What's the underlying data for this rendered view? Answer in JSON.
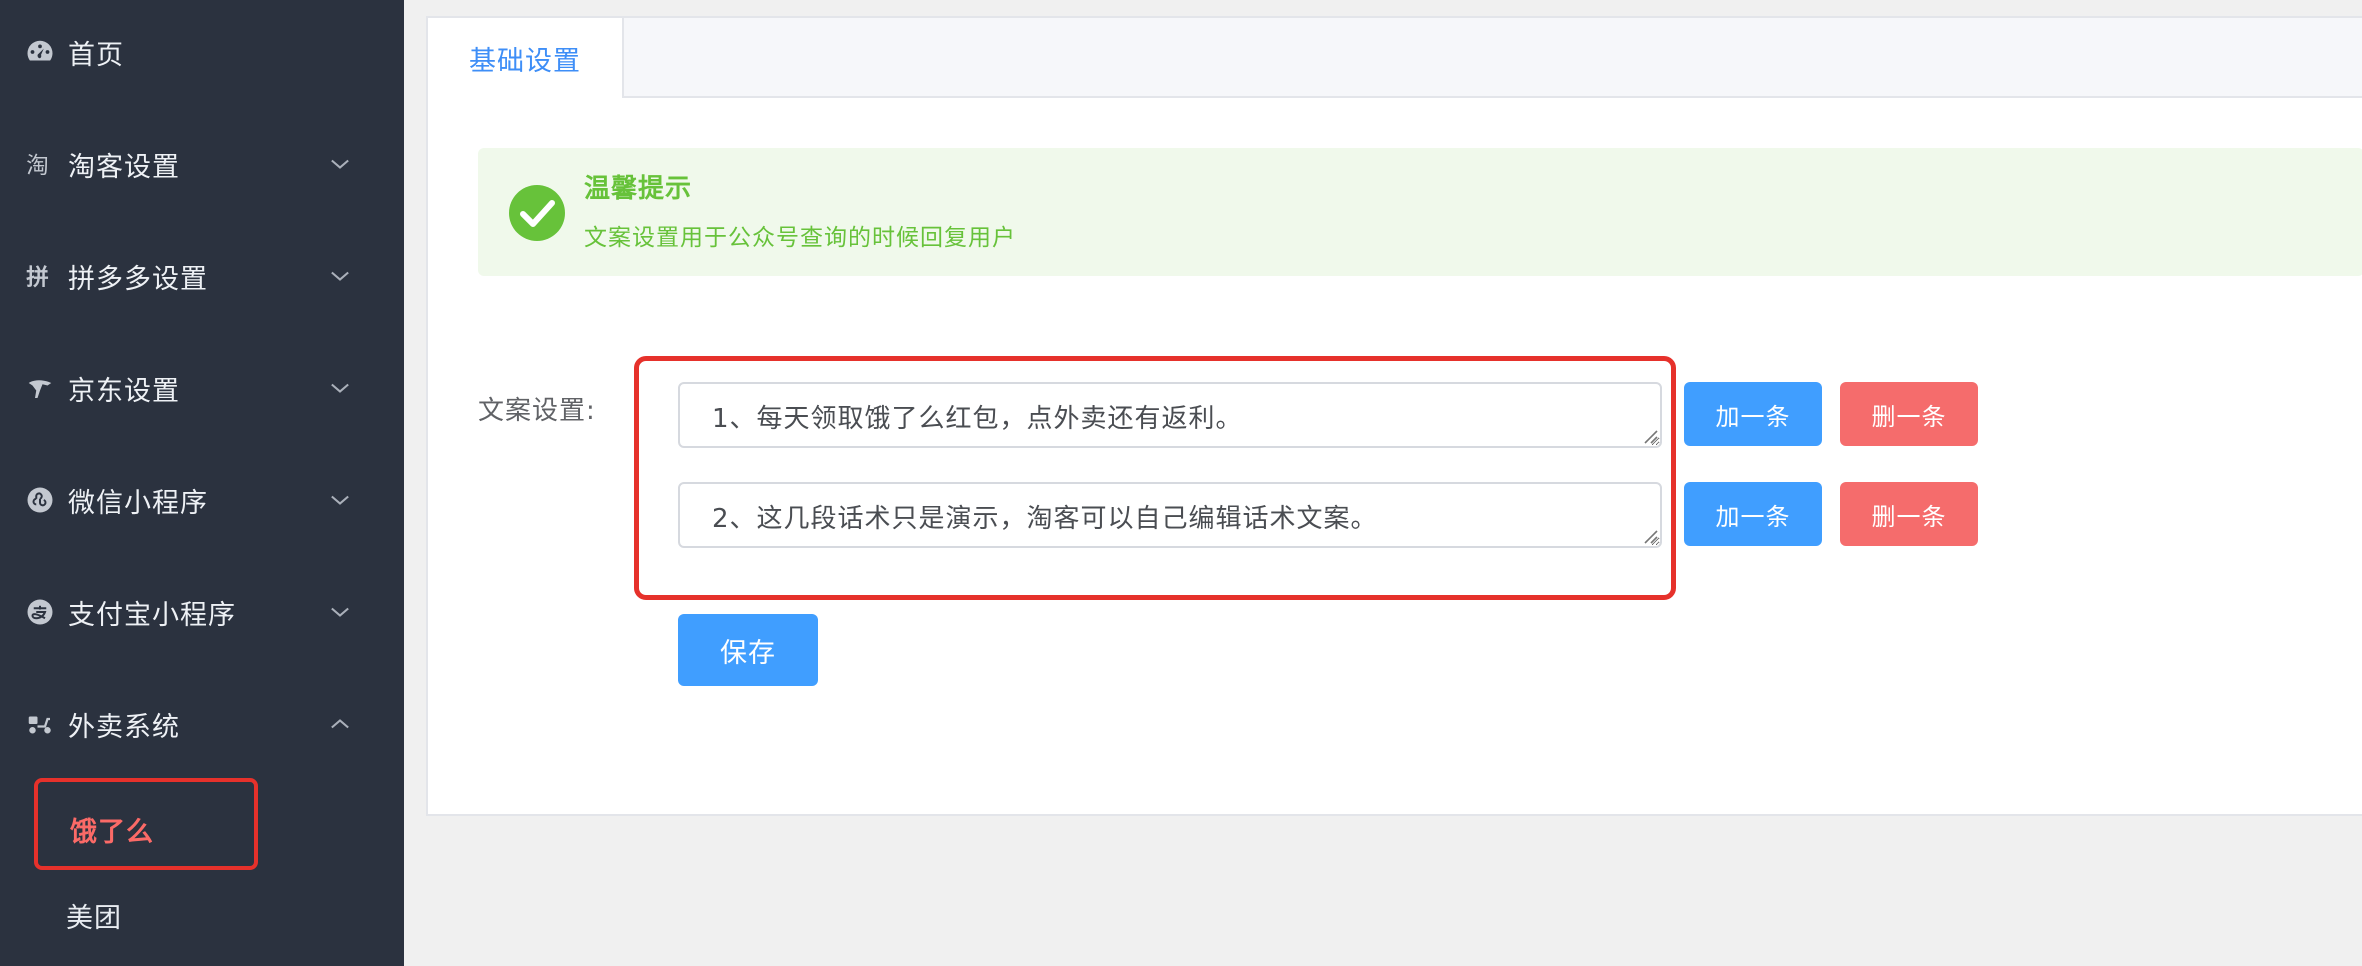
{
  "sidebar": {
    "items": [
      {
        "label": "首页",
        "icon": "dashboard-icon",
        "chevron": "none"
      },
      {
        "label": "淘客设置",
        "icon": "taobao-icon",
        "chevron": "down"
      },
      {
        "label": "拼多多设置",
        "icon": "pinduoduo-icon",
        "chevron": "down"
      },
      {
        "label": "京东设置",
        "icon": "jd-icon",
        "chevron": "down"
      },
      {
        "label": "微信小程序",
        "icon": "wechat-miniprogram-icon",
        "chevron": "down"
      },
      {
        "label": "支付宝小程序",
        "icon": "alipay-icon",
        "chevron": "down"
      },
      {
        "label": "外卖系统",
        "icon": "scooter-icon",
        "chevron": "up"
      }
    ],
    "sub_items": [
      {
        "label": "饿了么",
        "active": true
      },
      {
        "label": "美团",
        "active": false
      }
    ]
  },
  "tabs": [
    {
      "label": "基础设置",
      "active": true
    }
  ],
  "alert": {
    "title": "温馨提示",
    "description": "文案设置用于公众号查询的时候回复用户",
    "color": "#67c23a"
  },
  "form": {
    "label": "文案设置:",
    "rows": [
      {
        "text": "1、每天领取饿了么红包，点外卖还有返利。",
        "add_label": "加一条",
        "delete_label": "删一条"
      },
      {
        "text": "2、这几段话术只是演示，淘客可以自己编辑话术文案。",
        "add_label": "加一条",
        "delete_label": "删一条"
      }
    ],
    "save_label": "保存"
  },
  "colors": {
    "sidebar_bg": "#2b323f",
    "primary": "#409eff",
    "danger": "#f56c6c",
    "highlight": "#e6312b",
    "active_sub_text": "#fb6a67"
  }
}
